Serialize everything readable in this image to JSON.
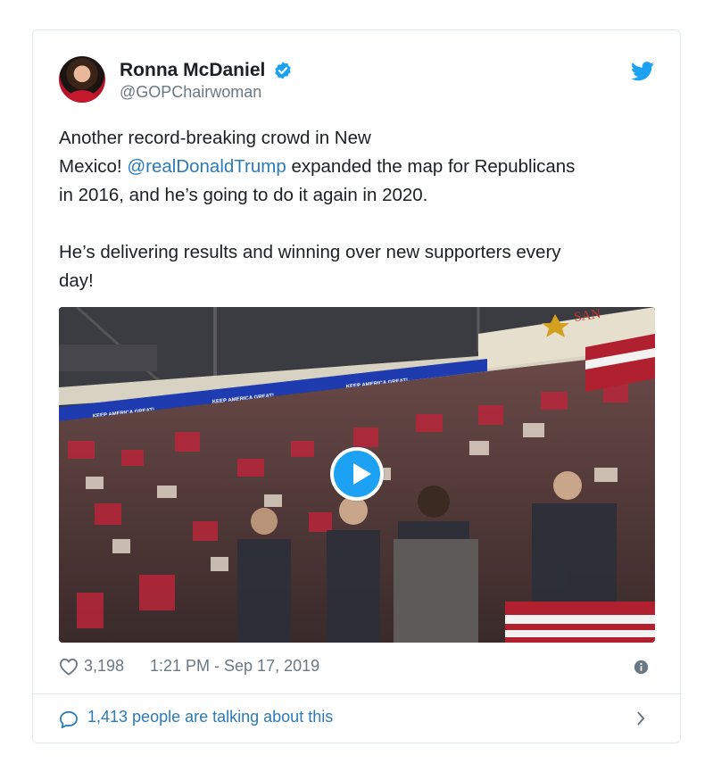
{
  "tweet": {
    "author_name": "Ronna McDaniel",
    "handle": "@GOPChairwoman",
    "verified": true,
    "text_line1": "Another record-breaking crowd in New",
    "text_line2_prefix": "Mexico! ",
    "mention": "@realDonaldTrump",
    "text_line2_suffix": " expanded the map for Republicans",
    "text_line3": "in 2016, and he’s going to do it again in 2020.",
    "text_para2_line1": "He’s delivering results and winning over new supporters every",
    "text_para2_line2": "day!",
    "media": {
      "banner_texts": [
        "KEEP AMERICA GREAT!",
        "KEEP AMERICA GREAT!",
        "KEEP AMERICA GREAT!"
      ],
      "corner_sign": "SAN"
    },
    "likes": "3,198",
    "timestamp": "1:21 PM - Sep 17, 2019",
    "talking": "1,413 people are talking about this"
  },
  "icons": {
    "verified": "verified-badge-icon",
    "twitter": "twitter-bird-icon",
    "heart": "heart-icon",
    "info": "info-icon",
    "chat": "speech-bubble-icon",
    "chevron": "chevron-right-icon"
  },
  "colors": {
    "twitter_blue": "#1da1f2",
    "link": "#2b7bb9",
    "muted": "#697882",
    "border": "#e1e8ed"
  }
}
